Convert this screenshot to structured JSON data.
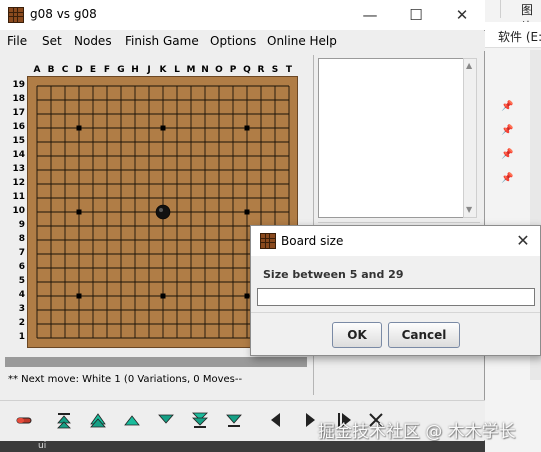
{
  "background": {
    "tab_label": "图片",
    "address_label": "软件 (E:",
    "taskbar_label": "ui"
  },
  "window": {
    "title": "g08 vs g08",
    "controls": {
      "minimize": "—",
      "maximize": "☐",
      "close": "✕"
    }
  },
  "menu": [
    "File",
    "Set",
    "Nodes",
    "Finish Game",
    "Options",
    "Online Help"
  ],
  "board": {
    "size": 19,
    "columns": [
      "A",
      "B",
      "C",
      "D",
      "E",
      "F",
      "G",
      "H",
      "J",
      "K",
      "L",
      "M",
      "N",
      "O",
      "P",
      "Q",
      "R",
      "S",
      "T"
    ],
    "rows": [
      "19",
      "18",
      "17",
      "16",
      "15",
      "14",
      "13",
      "12",
      "11",
      "10",
      "9",
      "8",
      "7",
      "6",
      "5",
      "4",
      "3",
      "2",
      "1"
    ],
    "hoshi": [
      [
        3,
        3
      ],
      [
        9,
        3
      ],
      [
        15,
        3
      ],
      [
        3,
        9
      ],
      [
        9,
        9
      ],
      [
        15,
        9
      ],
      [
        3,
        15
      ],
      [
        9,
        15
      ],
      [
        15,
        15
      ]
    ],
    "stones": [
      {
        "color": "black",
        "col": 9,
        "row": 9
      }
    ],
    "board_color": "#b07d46",
    "border_color": "#6b4724"
  },
  "status_text": "** Next move: White 1 (0 Variations, 0 Moves--",
  "toolbar": [
    "go-to-start-icon",
    "skip-back-icon",
    "back-one-icon",
    "forward-one-icon",
    "skip-forward-icon",
    "go-to-end-icon",
    "prev-variation-icon",
    "next-variation-icon",
    "up-variation-icon",
    "down-variation-icon",
    "delete-icon"
  ],
  "dialog": {
    "title": "Board size",
    "prompt": "Size between 5 and 29",
    "input_value": "",
    "ok_label": "OK",
    "cancel_label": "Cancel",
    "close_label": "✕"
  },
  "watermark": "掘金技术社区 @ 木木学长"
}
